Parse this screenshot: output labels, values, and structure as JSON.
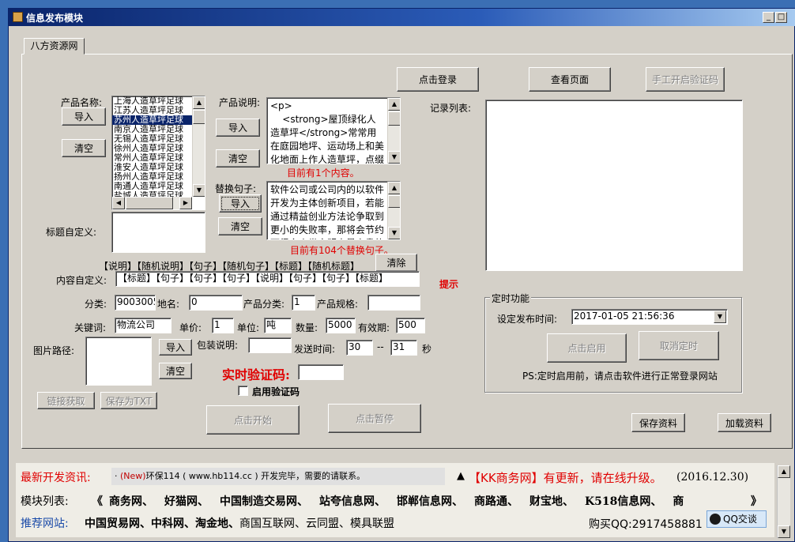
{
  "window": {
    "title": "信息发布模块",
    "min_label": "_",
    "max_label": "□",
    "scroll_up": "▲",
    "scroll_down": "▼"
  },
  "tab": {
    "label": "八方资源网"
  },
  "top_buttons": {
    "login": "点击登录",
    "view_page": "查看页面",
    "manual_captcha": "手工开启验证码"
  },
  "product_name": {
    "label": "产品名称:",
    "import": "导入",
    "clear": "清空",
    "items": [
      "上海人造草坪足球",
      "江苏人造草坪足球",
      "苏州人造草坪足球",
      "南京人造草坪足球",
      "无锡人造草坪足球",
      "徐州人造草坪足球",
      "常州人造草坪足球",
      "淮安人造草坪足球",
      "扬州人造草坪足球",
      "南通人造草坪足球",
      "盐城人造草坪足球"
    ],
    "selected_index": 2
  },
  "product_desc": {
    "label": "产品说明:",
    "import": "导入",
    "clear": "清空",
    "content": "<p>\n    <strong>屋顶绿化人造草坪</strong>常常用在庭园地坪、运动场上和美化地面上作人造草坪，点缀空",
    "count_text": "目前有1个内容。"
  },
  "replace_sentence": {
    "label": "替换句子:",
    "import": "导入",
    "clear": "清空",
    "content": "软件公司或公司内的以软件开发为主体创新项目，若能通过精益创业方法论争取到更小的失败率，那将会节约下很多人类文明中最宝贵的",
    "count_text": "目前有104个替换句子。"
  },
  "title_custom": {
    "label": "标题自定义:",
    "value": ""
  },
  "tokens": {
    "line": "【说明】【随机说明】【句子】【随机句子】【标题】【随机标题】",
    "clear": "清除"
  },
  "content_custom": {
    "label": "内容自定义:",
    "value": "【标题】【句子】【句子】【句子】【说明】【句子】【句子】【标题】"
  },
  "hint": "提示",
  "fields": {
    "category_label": "分类:",
    "category": "9003005",
    "location_label": "地名:",
    "location": "0",
    "product_category_label": "产品分类:",
    "product_category": "1",
    "spec_label": "产品规格:",
    "spec": "",
    "keyword_label": "关键词:",
    "keyword": "物流公司",
    "price_label": "单价:",
    "price": "1",
    "unit_label": "单位:",
    "unit": "吨",
    "qty_label": "数量:",
    "qty": "5000",
    "validity_label": "有效期:",
    "validity": "500",
    "packaging_label": "包装说明:",
    "packaging": "",
    "send_time_label": "发送时间:",
    "send_from": "30",
    "send_dash": "--",
    "send_to": "31",
    "send_unit": "秒"
  },
  "image_path": {
    "label": "图片路径:",
    "import": "导入",
    "clear": "清空"
  },
  "captcha": {
    "label": "实时验证码:",
    "value": "",
    "enable_label": "启用验证码",
    "enabled": false
  },
  "link_buttons": {
    "fetch_link": "链接获取",
    "save_txt": "保存为TXT"
  },
  "action_buttons": {
    "start": "点击开始",
    "pause": "点击暂停"
  },
  "records": {
    "label": "记录列表:"
  },
  "timer": {
    "group_title": "定时功能",
    "set_time_label": "设定发布时间:",
    "datetime": "2017-01-05 21:56:36",
    "start": "点击启用",
    "cancel": "取消定时",
    "note": "PS:定时启用前，请点击软件进行正常登录网站"
  },
  "save_buttons": {
    "save": "保存资料",
    "load": "加载资料"
  },
  "bottom": {
    "news_label": "最新开发资讯:",
    "news_bullet": "·",
    "news_new": "(New)",
    "news_text": "环保114 ( www.hb114.cc ) 开发完毕，需要的请联系。",
    "update_arrow": "▲",
    "update_text": "【KK商务网】有更新，请在线升级。",
    "update_date": "(2016.12.30)",
    "modules_label": "模块列表:",
    "module_prev": "《",
    "module_next": "》",
    "modules": [
      "商务网、",
      "好猫网、",
      "中国制造交易网、",
      "站夸信息网、",
      "邯郸信息网、",
      "商路通、",
      "财宝地、",
      "K518信息网、",
      "商"
    ],
    "recommend_label": "推荐网站:",
    "recommend_bold": [
      "中国贸易网、",
      "中科网、",
      "淘金地、"
    ],
    "recommend_normal": [
      "商国互联网、",
      "云同盟、",
      "模具联盟"
    ],
    "qq_text": "购买QQ:2917458881",
    "qq_button": "QQ交谈"
  }
}
